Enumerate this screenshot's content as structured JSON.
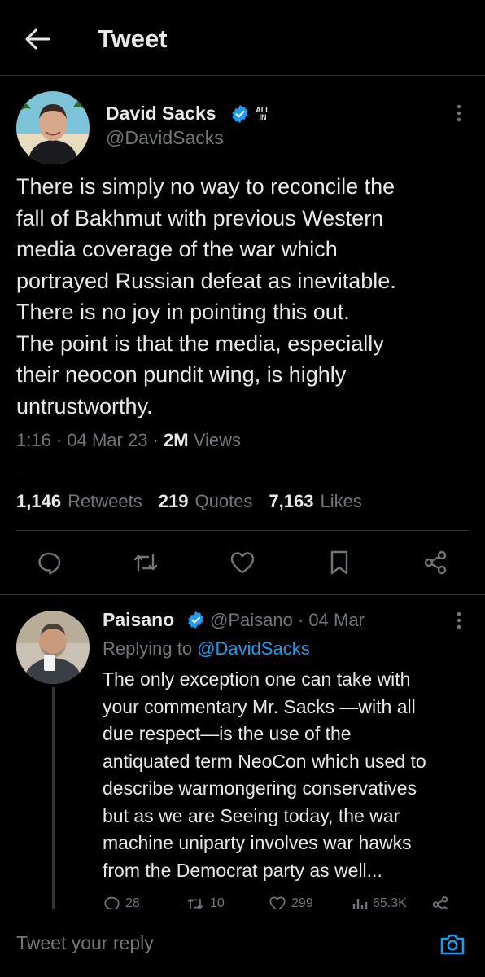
{
  "header": {
    "title": "Tweet"
  },
  "main_tweet": {
    "author_name": "David Sacks",
    "affiliation_badge": "ALL IN",
    "handle": "@DavidSacks",
    "text": "There is simply no way to reconcile the\nfall of Bakhmut with previous Western\nmedia coverage of the war which\nportrayed Russian defeat as inevitable.\nThere is no joy in pointing this out.\nThe point is that the media, especially\ntheir neocon pundit wing, is highly\nuntrustworthy.",
    "time": "1:16",
    "date": "04 Mar 23",
    "views_count": "2M",
    "views_label": "Views",
    "stats": {
      "retweets_count": "1,146",
      "retweets_label": "Retweets",
      "quotes_count": "219",
      "quotes_label": "Quotes",
      "likes_count": "7,163",
      "likes_label": "Likes"
    }
  },
  "reply": {
    "author_name": "Paisano",
    "handle": "@Paisano",
    "date": "04 Mar",
    "replying_label": "Replying to",
    "replying_to": "@DavidSacks",
    "text": "The only exception one can take with\nyour commentary Mr. Sacks —with all\ndue respect—is the use of the\nantiquated term NeoCon which used to\ndescribe warmongering conservatives\nbut as we are Seeing today, the war\nmachine uniparty involves war hawks\nfrom the Democrat party as well...",
    "counts": {
      "replies": "28",
      "retweets": "10",
      "likes": "299",
      "views": "65.3K"
    }
  },
  "compose": {
    "placeholder": "Tweet your reply"
  },
  "colors": {
    "background": "#000000",
    "text": "#e7e9ea",
    "muted": "#71767b",
    "accent": "#1d9bf0",
    "divider": "#2f3336"
  },
  "icons": [
    "back-arrow-icon",
    "verified-icon",
    "more-vertical-icon",
    "reply-icon",
    "retweet-icon",
    "like-icon",
    "bookmark-icon",
    "share-icon",
    "views-icon",
    "camera-icon"
  ]
}
